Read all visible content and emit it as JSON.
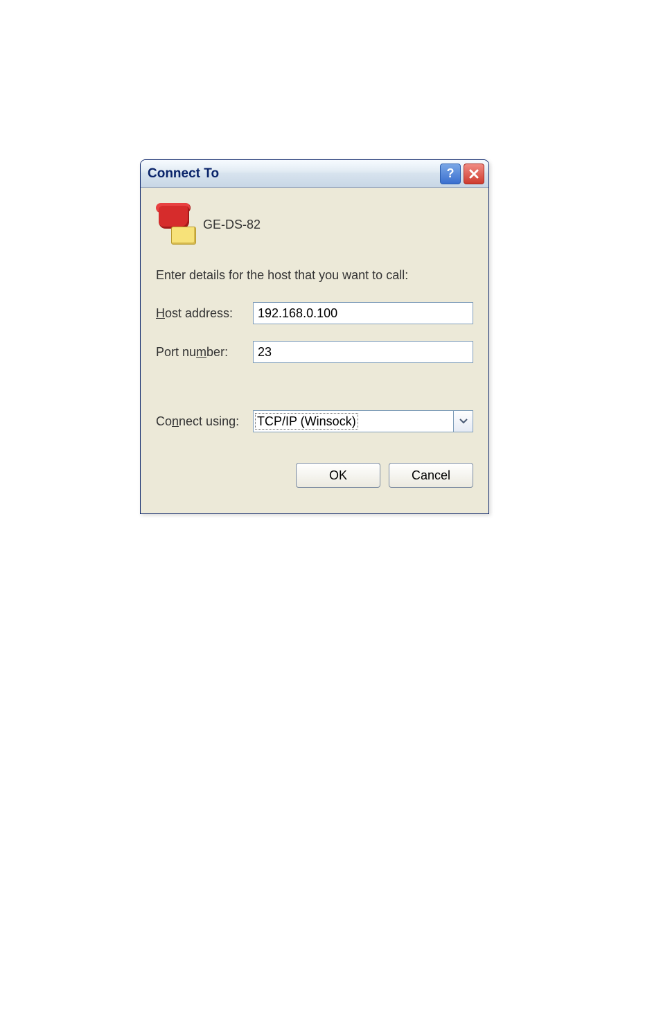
{
  "dialog": {
    "title": "Connect To",
    "connection_name": "GE-DS-82",
    "instruction": "Enter details for the host that you want to call:",
    "labels": {
      "host_address_pre": "H",
      "host_address_post": "ost address:",
      "port_number_pre": "Port nu",
      "port_number_accel": "m",
      "port_number_post": "ber:",
      "connect_using_pre": "Co",
      "connect_using_accel": "n",
      "connect_using_post": "nect using:"
    },
    "fields": {
      "host_address": "192.168.0.100",
      "port_number": "23",
      "connect_using_selected": "TCP/IP (Winsock)"
    },
    "buttons": {
      "ok": "OK",
      "cancel": "Cancel"
    }
  }
}
